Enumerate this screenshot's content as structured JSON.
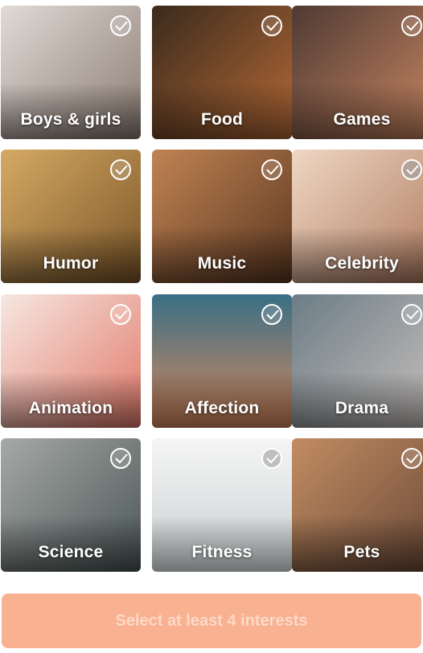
{
  "interests": [
    {
      "key": "boys_girls",
      "label": "Boys & girls",
      "colors": [
        "#d8d4d0",
        "#7a6e68"
      ]
    },
    {
      "key": "food",
      "label": "Food",
      "colors": [
        "#3b2a1c",
        "#a0582b"
      ]
    },
    {
      "key": "games",
      "label": "Games",
      "colors": [
        "#4a3530",
        "#c47a5c"
      ]
    },
    {
      "key": "humor",
      "label": "Humor",
      "colors": [
        "#c99a57",
        "#7a5526"
      ]
    },
    {
      "key": "music",
      "label": "Music",
      "colors": [
        "#c0814f",
        "#5a3621"
      ]
    },
    {
      "key": "celebrity",
      "label": "Celebrity",
      "colors": [
        "#e6c9b4",
        "#b07f62"
      ]
    },
    {
      "key": "animation",
      "label": "Animation",
      "colors": [
        "#f1d8d2",
        "#e07a6b"
      ]
    },
    {
      "key": "affection",
      "label": "Affection",
      "colors": [
        "#3a6f85",
        "#d8895b"
      ]
    },
    {
      "key": "drama",
      "label": "Drama",
      "colors": [
        "#6c7d86",
        "#c8c0bd"
      ]
    },
    {
      "key": "science",
      "label": "Science",
      "colors": [
        "#8c8f8e",
        "#4a5656"
      ]
    },
    {
      "key": "fitness",
      "label": "Fitness",
      "colors": [
        "#f1f1f1",
        "#c0c7c9"
      ]
    },
    {
      "key": "pets",
      "label": "Pets",
      "colors": [
        "#b47b56",
        "#6b4a38"
      ]
    }
  ],
  "cta": {
    "label": "Select at least 4 interests"
  }
}
